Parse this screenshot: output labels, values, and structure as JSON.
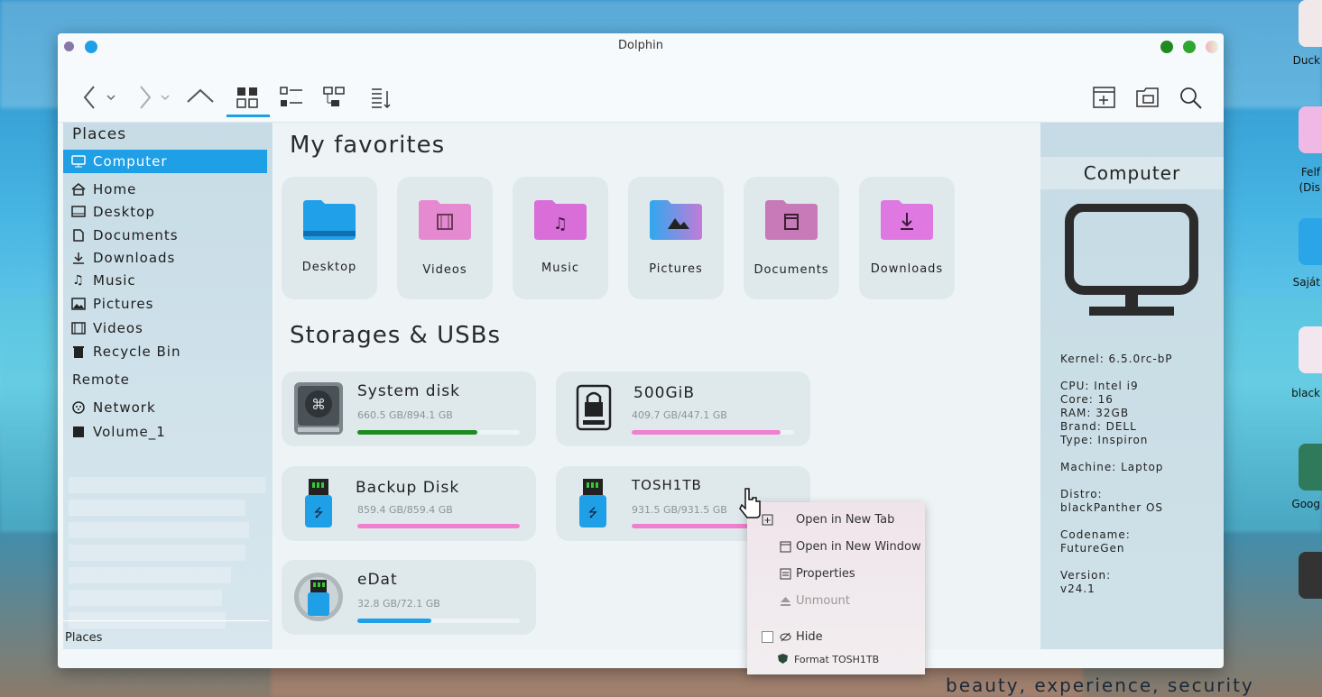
{
  "window": {
    "title": "Dolphin"
  },
  "colors": {
    "accent": "#1f9fe6",
    "green_bar": "#1f8a1f",
    "pink_bar": "#f07fcf",
    "blue_bar": "#1f9fe6"
  },
  "toolbar": {
    "back": "chevron-left-icon",
    "forward": "chevron-right-icon",
    "up": "chevron-up-icon",
    "views": [
      "icons-view-icon",
      "details-view-icon",
      "tree-view-icon",
      "sort-icon"
    ],
    "right": [
      "new-tab-icon",
      "folder-properties-icon",
      "search-icon"
    ]
  },
  "sidebar": {
    "places_heading": "Places",
    "places": [
      {
        "label": "Computer",
        "icon": "monitor-icon"
      },
      {
        "label": "Home",
        "icon": "home-icon"
      },
      {
        "label": "Desktop",
        "icon": "desktop-icon"
      },
      {
        "label": "Documents",
        "icon": "document-icon"
      },
      {
        "label": "Downloads",
        "icon": "download-icon"
      },
      {
        "label": "Music",
        "icon": "music-icon"
      },
      {
        "label": "Pictures",
        "icon": "picture-icon"
      },
      {
        "label": "Videos",
        "icon": "video-icon"
      },
      {
        "label": "Recycle Bin",
        "icon": "trash-icon"
      }
    ],
    "remote_heading": "Remote",
    "remote": [
      {
        "label": "Network",
        "icon": "network-icon"
      },
      {
        "label": "Volume_1",
        "icon": "server-icon"
      }
    ],
    "footer": "Places"
  },
  "main": {
    "favorites_title": "My favorites",
    "favorites": [
      {
        "label": "Desktop",
        "color": "#1fa0e8"
      },
      {
        "label": "Videos",
        "color": "#e58ad0"
      },
      {
        "label": "Music",
        "color": "#d96ed8"
      },
      {
        "label": "Pictures",
        "color": "#3aa7ef"
      },
      {
        "label": "Documents",
        "color": "#c779b8"
      },
      {
        "label": "Downloads",
        "color": "#df78e0"
      }
    ],
    "storage_title": "Storages & USBs",
    "drives": [
      {
        "name": "System disk",
        "size": "660.5 GB/894.1 GB",
        "used": 0.739,
        "color": "#1f8a1f"
      },
      {
        "name": "500GiB",
        "size": "409.7 GB/447.1 GB",
        "used": 0.916,
        "color": "#f07fcf"
      },
      {
        "name": "Backup Disk",
        "size": "859.4 GB/859.4 GB",
        "used": 1.0,
        "color": "#f07fcf"
      },
      {
        "name": "TOSH1TB",
        "size": "931.5 GB/931.5 GB",
        "used": 1.0,
        "color": "#f07fcf"
      },
      {
        "name": "eDat",
        "size": "32.8 GB/72.1 GB",
        "used": 0.455,
        "color": "#1f9fe6"
      }
    ]
  },
  "info": {
    "title": "Computer",
    "lines": [
      "Kernel: 6.5.0rc-bP",
      "CPU: Intel i9",
      "Core: 16",
      "RAM: 32GB",
      "Brand: DELL",
      "Type: Inspiron",
      "Machine: Laptop",
      "Distro:",
      "blackPanther OS",
      "Codename:",
      "FutureGen",
      "Version:",
      "v24.1"
    ]
  },
  "context_menu": {
    "items": [
      {
        "label": "Open in New Tab",
        "enabled": true
      },
      {
        "label": "Open in New Window",
        "enabled": true
      },
      {
        "label": "Properties",
        "enabled": true
      },
      {
        "label": "Unmount",
        "enabled": false
      },
      {
        "label": "Hide",
        "enabled": true
      },
      {
        "label": "Format TOSH1TB",
        "enabled": true
      }
    ]
  },
  "desktop": {
    "labels": [
      "Duck",
      "Felf",
      "(Dis",
      "Saját",
      "black",
      "Goog"
    ],
    "tagline": "beauty, experience, security"
  }
}
